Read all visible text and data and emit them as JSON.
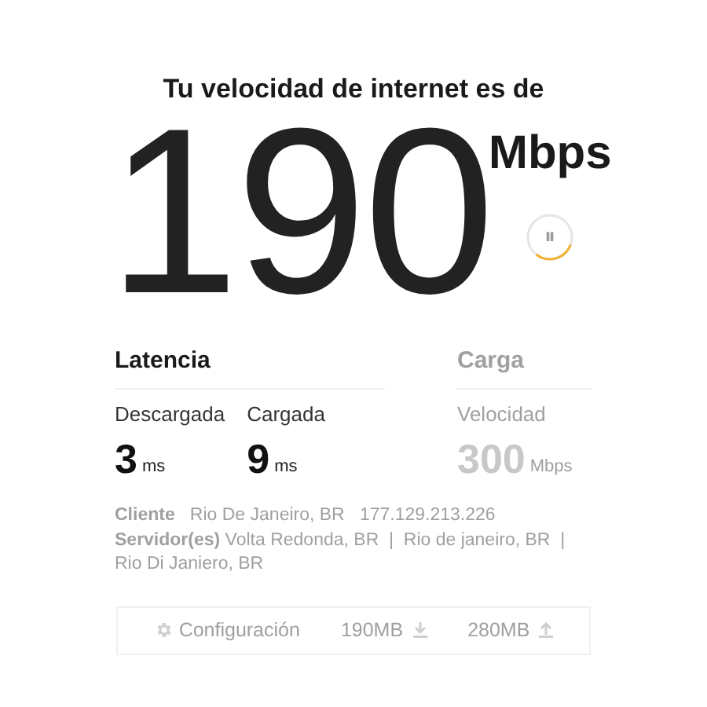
{
  "heading": "Tu velocidad de internet es de",
  "speed": {
    "value": "190",
    "unit": "Mbps"
  },
  "pause_button": {
    "label": "⏸"
  },
  "sections": [
    {
      "title": "Latencia",
      "disabled": false,
      "metrics": [
        {
          "label": "Descargada",
          "value": "3",
          "unit": "ms"
        },
        {
          "label": "Cargada",
          "value": "9",
          "unit": "ms"
        }
      ]
    },
    {
      "title": "Carga",
      "disabled": true,
      "metrics": [
        {
          "label": "Velocidad",
          "value": "300",
          "unit": "Mbps"
        }
      ]
    }
  ],
  "info": [
    "**Cliente**   Rio De Janeiro, BR   177.129.213.226",
    "**Servidor(es)** Volta Redonda, BR  |  Rio de janeiro, BR  |  Rio Di Janiero, BR"
  ],
  "footer": {
    "settings": "Configuración",
    "stats": [
      {
        "kind": "download",
        "value": "190MB"
      },
      {
        "kind": "upload",
        "value": "280MB"
      }
    ]
  }
}
